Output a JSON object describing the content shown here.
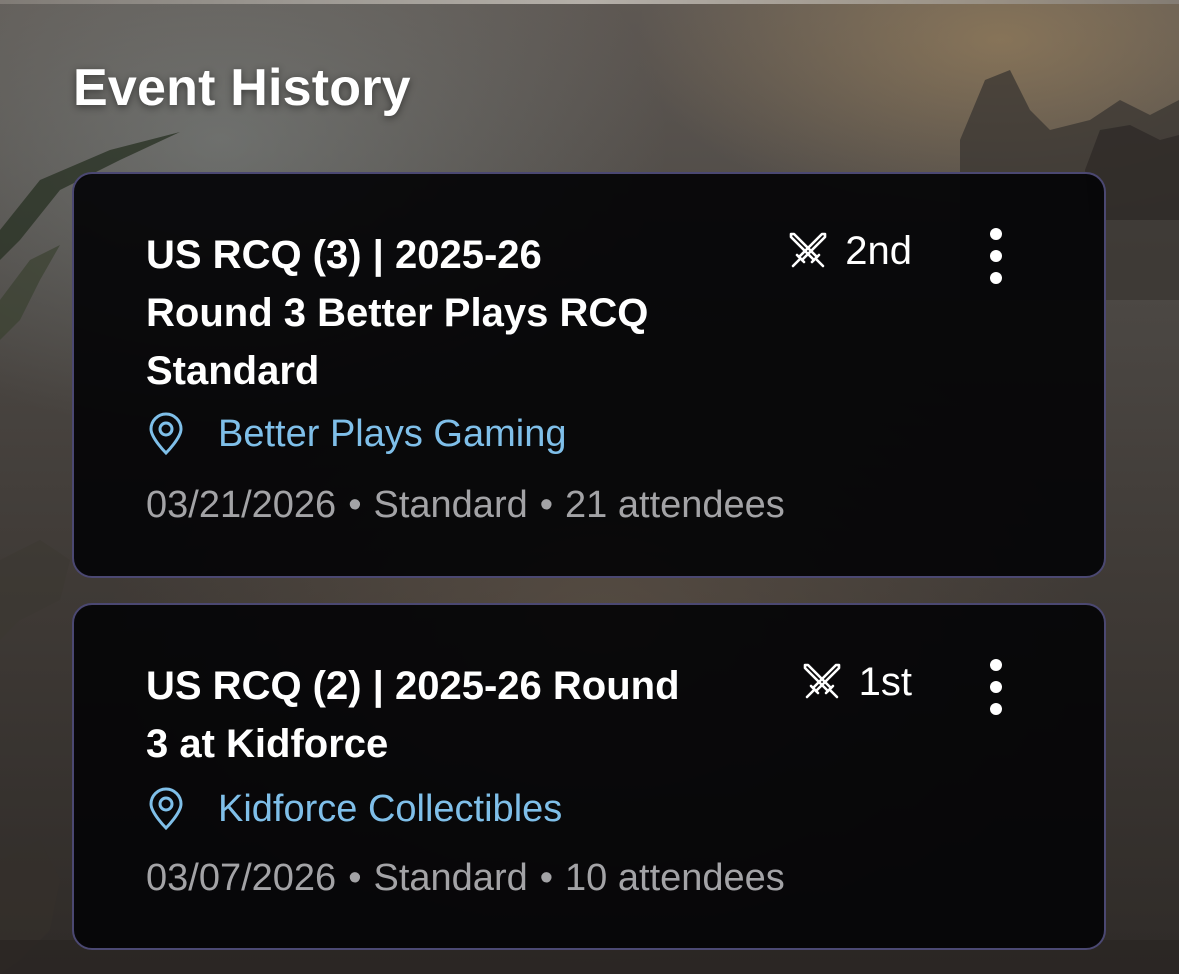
{
  "colors": {
    "card_background": "#040406",
    "card_border": "#4b4872",
    "title_text": "#ffffff",
    "venue_link": "#7fbfe9",
    "meta_text": "#a3a3a6"
  },
  "page": {
    "title": "Event History"
  },
  "events": [
    {
      "title_lines": [
        "US RCQ (3) | 2025-26",
        "Round 3 Better Plays RCQ",
        "Standard"
      ],
      "placement_icon": "crossed-swords-icon",
      "placement": "2nd",
      "more_icon": "vertical-ellipsis-icon",
      "location_icon": "map-pin-icon",
      "venue": "Better Plays Gaming",
      "date": "03/21/2026",
      "format": "Standard",
      "attendees": "21 attendees",
      "separator": "•"
    },
    {
      "title_lines": [
        "US RCQ (2) | 2025-26 Round",
        "3 at Kidforce"
      ],
      "placement_icon": "crossed-swords-icon",
      "placement": "1st",
      "more_icon": "vertical-ellipsis-icon",
      "location_icon": "map-pin-icon",
      "venue": "Kidforce Collectibles",
      "date": "03/07/2026",
      "format": "Standard",
      "attendees": "10 attendees",
      "separator": "•"
    }
  ]
}
